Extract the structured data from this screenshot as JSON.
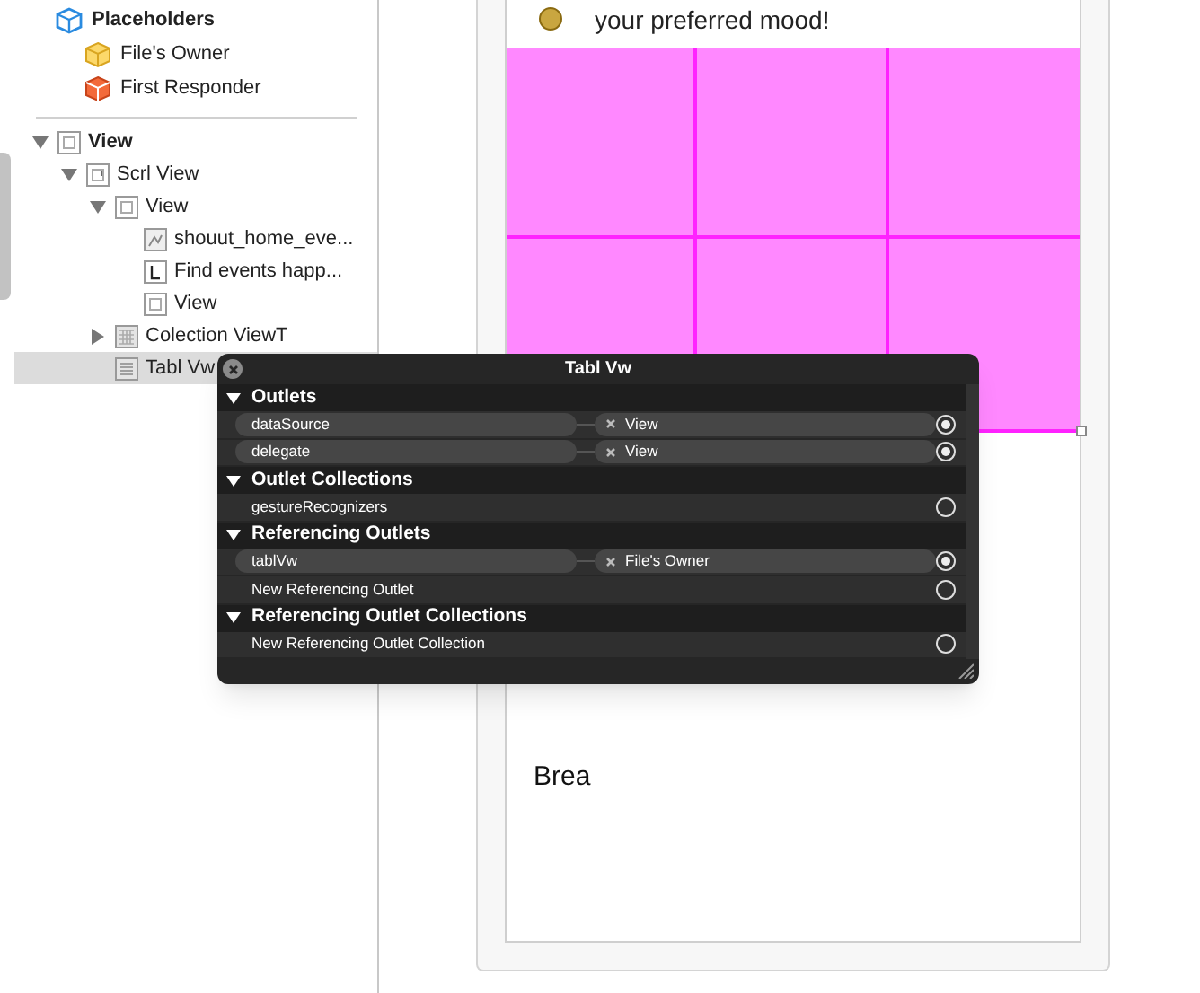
{
  "placeholders": {
    "title": "Placeholders",
    "items": [
      {
        "label": "File's Owner",
        "kind": "owner"
      },
      {
        "label": "First Responder",
        "kind": "responder"
      }
    ]
  },
  "tree": [
    {
      "label": "View",
      "kind": "view",
      "expanded": true,
      "selected": false,
      "children": [
        {
          "label": "Scrl View",
          "kind": "scroll",
          "expanded": true,
          "selected": false,
          "children": [
            {
              "label": "View",
              "kind": "view",
              "expanded": true,
              "selected": false,
              "children": [
                {
                  "label": "shouut_home_eve...",
                  "kind": "image",
                  "selected": false
                },
                {
                  "label": "Find events happ...",
                  "kind": "label",
                  "selected": false
                },
                {
                  "label": "View",
                  "kind": "view",
                  "selected": false
                }
              ]
            },
            {
              "label": "Colection ViewT",
              "kind": "collection",
              "expanded": false,
              "selected": false
            },
            {
              "label": "Tabl Vw",
              "kind": "table",
              "selected": true
            }
          ]
        }
      ]
    }
  ],
  "canvas": {
    "top_text": "your preferred mood!",
    "bottom_text": "Brea"
  },
  "popup": {
    "title": "Tabl Vw",
    "sections": [
      {
        "title": "Outlets",
        "expanded": true,
        "rows": [
          {
            "name": "dataSource",
            "target": "View",
            "connected": true
          },
          {
            "name": "delegate",
            "target": "View",
            "connected": true
          }
        ]
      },
      {
        "title": "Outlet Collections",
        "expanded": true,
        "rows": [
          {
            "name": "gestureRecognizers",
            "connected": false
          }
        ]
      },
      {
        "title": "Referencing Outlets",
        "expanded": true,
        "rows": [
          {
            "name": "tablVw",
            "target": "File's Owner",
            "connected": true
          },
          {
            "name": "New Referencing Outlet",
            "connected": false
          }
        ]
      },
      {
        "title": "Referencing Outlet Collections",
        "expanded": true,
        "rows": [
          {
            "name": "New Referencing Outlet Collection",
            "connected": false
          }
        ]
      }
    ]
  }
}
